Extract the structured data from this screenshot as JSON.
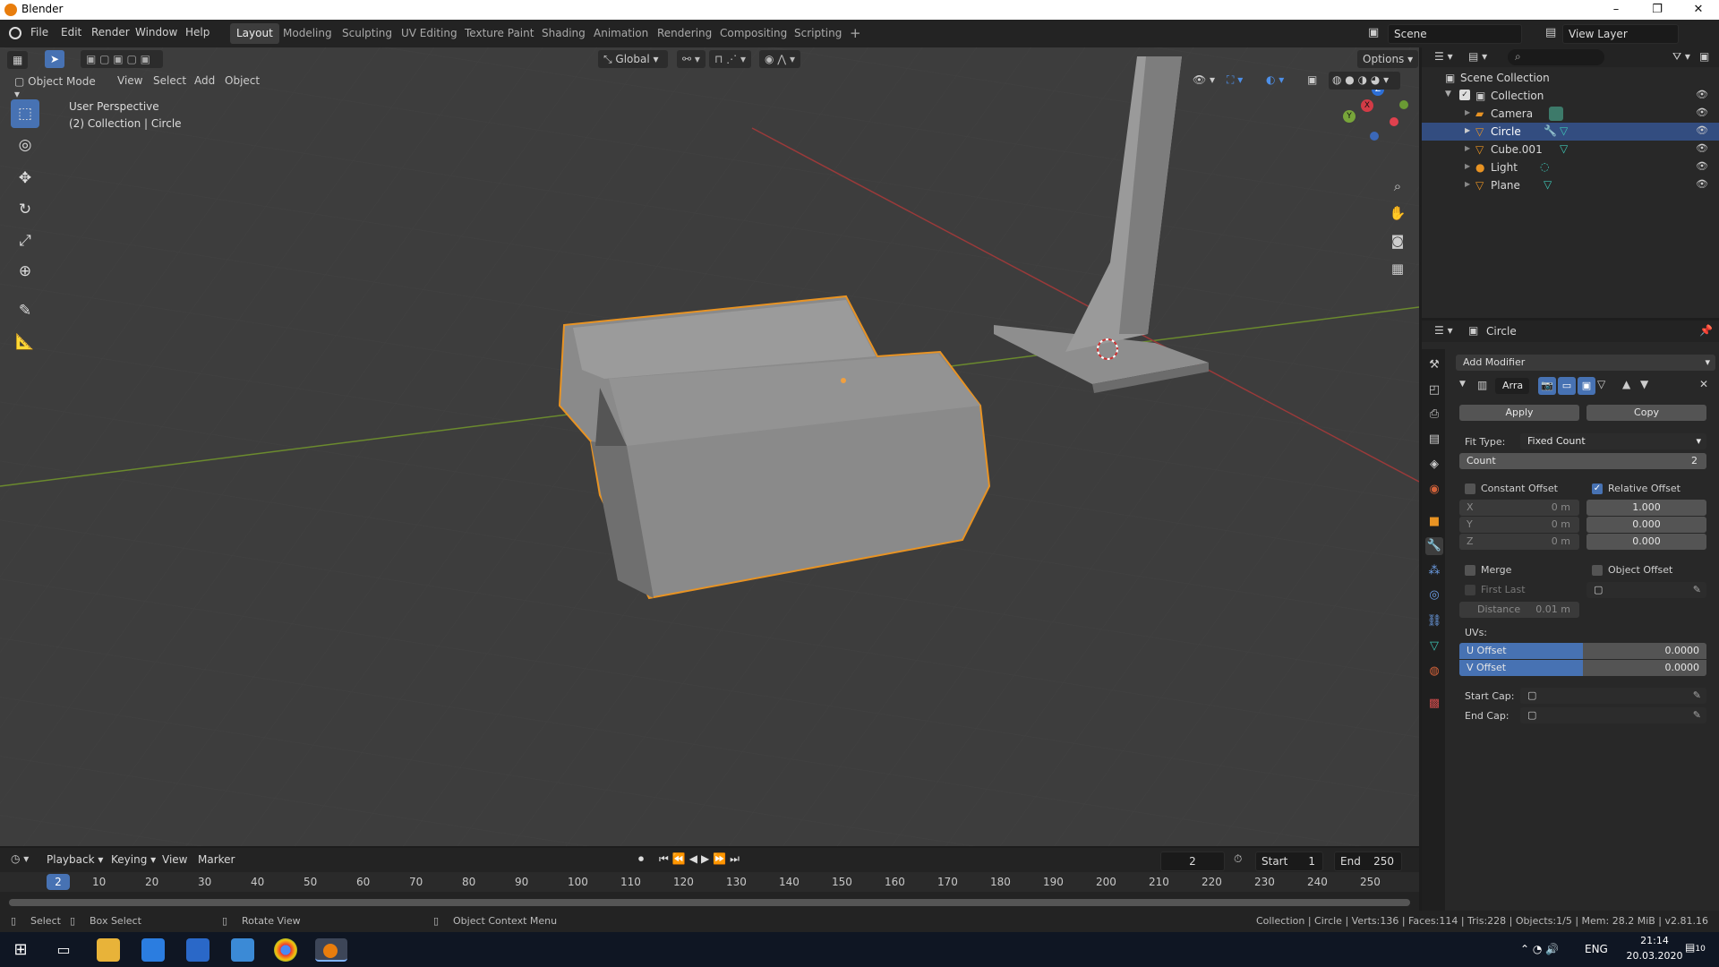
{
  "os": {
    "title": "Blender",
    "min": "–",
    "max": "❐",
    "close": "✕"
  },
  "menus": [
    "File",
    "Edit",
    "Render",
    "Window",
    "Help"
  ],
  "workspaces": [
    "Layout",
    "Modeling",
    "Sculpting",
    "UV Editing",
    "Texture Paint",
    "Shading",
    "Animation",
    "Rendering",
    "Compositing",
    "Scripting"
  ],
  "add_workspace": "+",
  "scene": {
    "name": "Scene",
    "view_layer": "View Layer"
  },
  "header": {
    "transform": "Global",
    "options": "Options"
  },
  "viewport_menu": {
    "mode": "Object Mode",
    "view": "View",
    "select": "Select",
    "add": "Add",
    "object": "Object"
  },
  "overlay_text": {
    "perspective": "User Perspective",
    "collection": "(2) Collection | Circle"
  },
  "gizmo": {
    "x": "X",
    "y": "Y",
    "z": "Z"
  },
  "outliner": {
    "root": "Scene Collection",
    "collection": "Collection",
    "items": [
      {
        "name": "Camera",
        "selected": false
      },
      {
        "name": "Circle",
        "selected": true
      },
      {
        "name": "Cube.001",
        "selected": false
      },
      {
        "name": "Light",
        "selected": false
      },
      {
        "name": "Plane",
        "selected": false
      }
    ]
  },
  "properties": {
    "object_name": "Circle",
    "add_modifier": "Add Modifier",
    "modifier_name": "Arra",
    "apply": "Apply",
    "copy": "Copy",
    "fit_type_label": "Fit Type:",
    "fit_type_value": "Fixed Count",
    "count_label": "Count",
    "count_value": "2",
    "constant_offset": "Constant Offset",
    "relative_offset": "Relative Offset",
    "x": "X",
    "y": "Y",
    "z": "Z",
    "const_x": "0 m",
    "const_y": "0 m",
    "const_z": "0 m",
    "rel_x": "1.000",
    "rel_y": "0.000",
    "rel_z": "0.000",
    "merge": "Merge",
    "object_offset": "Object Offset",
    "first_last": "First Last",
    "distance_label": "Distance",
    "distance_value": "0.01 m",
    "uvs": "UVs:",
    "u_offset_label": "U Offset",
    "u_offset_value": "0.0000",
    "v_offset_label": "V Offset",
    "v_offset_value": "0.0000",
    "start_cap": "Start Cap:",
    "end_cap": "End Cap:",
    "constant_offset_checked": false,
    "relative_offset_checked": true
  },
  "timeline": {
    "playback": "Playback",
    "keying": "Keying",
    "view": "View",
    "marker": "Marker",
    "current_frame": "2",
    "start_label": "Start",
    "start_value": "1",
    "end_label": "End",
    "end_value": "250",
    "ticks": [
      "10",
      "20",
      "30",
      "40",
      "50",
      "60",
      "70",
      "80",
      "90",
      "100",
      "110",
      "120",
      "130",
      "140",
      "150",
      "160",
      "170",
      "180",
      "190",
      "200",
      "210",
      "220",
      "230",
      "240",
      "250"
    ],
    "playhead": "2"
  },
  "status": {
    "select": "Select",
    "box_select": "Box Select",
    "rotate_view": "Rotate View",
    "context_menu": "Object Context Menu",
    "stats": "Collection | Circle | Verts:136 | Faces:114 | Tris:228 | Objects:1/5 | Mem: 28.2 MiB | v2.81.16"
  },
  "taskbar": {
    "lang": "ENG",
    "time": "21:14",
    "date": "20.03.2020",
    "notif": "10"
  },
  "colors": {
    "accent": "#4772b3",
    "selection": "#e89323",
    "panel": "#282828",
    "viewport": "#3d3d3d"
  }
}
